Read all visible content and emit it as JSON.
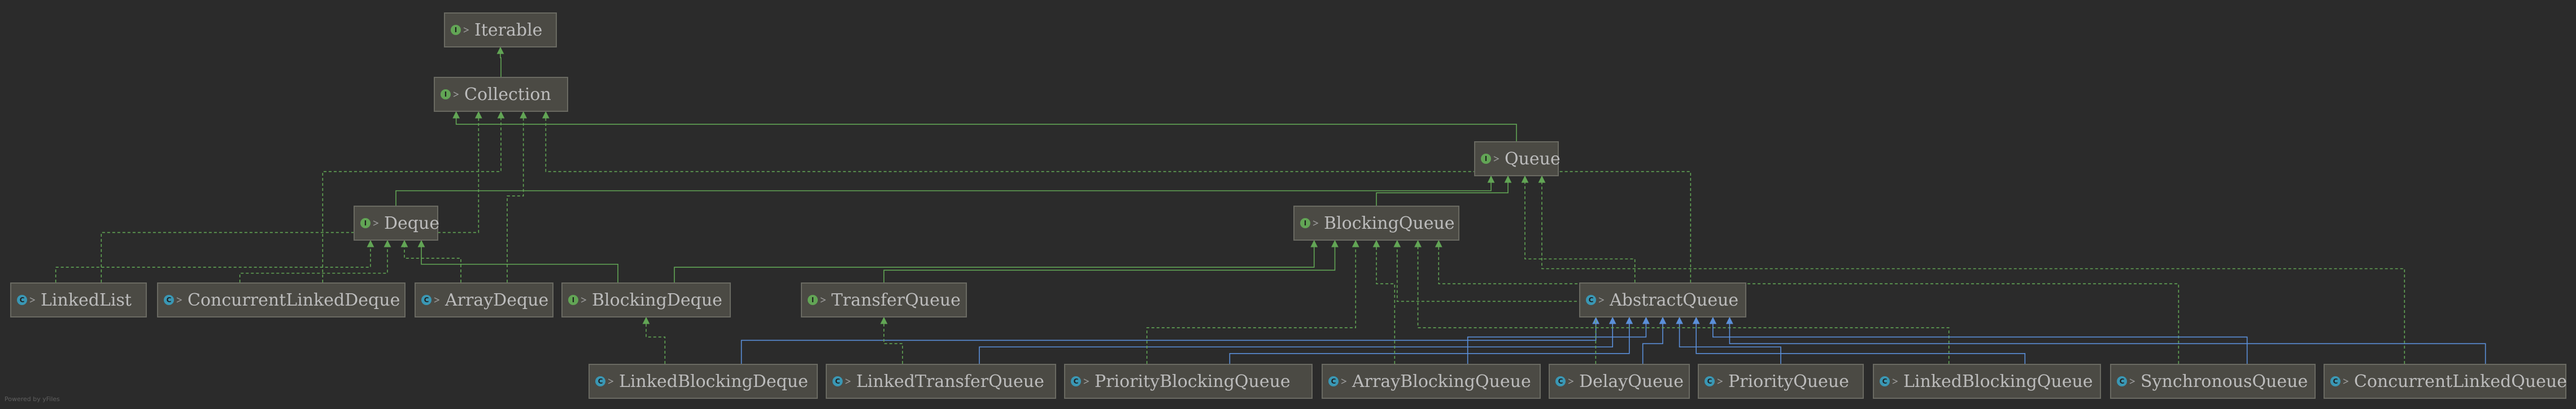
{
  "diagram": {
    "nodes": [
      {
        "id": "Iterable",
        "label": "Iterable",
        "kind": "interface",
        "icon": "interface-icon"
      },
      {
        "id": "Collection",
        "label": "Collection",
        "kind": "interface",
        "icon": "interface-icon"
      },
      {
        "id": "Queue",
        "label": "Queue",
        "kind": "interface",
        "icon": "interface-icon"
      },
      {
        "id": "Deque",
        "label": "Deque",
        "kind": "interface",
        "icon": "interface-icon"
      },
      {
        "id": "BlockingQueue",
        "label": "BlockingQueue",
        "kind": "interface",
        "icon": "interface-icon"
      },
      {
        "id": "LinkedList",
        "label": "LinkedList",
        "kind": "class",
        "icon": "class-icon"
      },
      {
        "id": "ConcurrentLinkedDeque",
        "label": "ConcurrentLinkedDeque",
        "kind": "class",
        "icon": "class-icon"
      },
      {
        "id": "ArrayDeque",
        "label": "ArrayDeque",
        "kind": "class",
        "icon": "class-icon"
      },
      {
        "id": "BlockingDeque",
        "label": "BlockingDeque",
        "kind": "interface",
        "icon": "interface-icon"
      },
      {
        "id": "TransferQueue",
        "label": "TransferQueue",
        "kind": "interface",
        "icon": "interface-icon"
      },
      {
        "id": "AbstractQueue",
        "label": "AbstractQueue",
        "kind": "class",
        "icon": "class-icon"
      },
      {
        "id": "LinkedBlockingDeque",
        "label": "LinkedBlockingDeque",
        "kind": "class",
        "icon": "class-icon"
      },
      {
        "id": "LinkedTransferQueue",
        "label": "LinkedTransferQueue",
        "kind": "class",
        "icon": "class-icon"
      },
      {
        "id": "PriorityBlockingQueue",
        "label": "PriorityBlockingQueue",
        "kind": "class",
        "icon": "class-icon"
      },
      {
        "id": "ArrayBlockingQueue",
        "label": "ArrayBlockingQueue",
        "kind": "class",
        "icon": "class-icon"
      },
      {
        "id": "DelayQueue",
        "label": "DelayQueue",
        "kind": "class",
        "icon": "class-icon"
      },
      {
        "id": "PriorityQueue",
        "label": "PriorityQueue",
        "kind": "class",
        "icon": "class-icon"
      },
      {
        "id": "LinkedBlockingQueue",
        "label": "LinkedBlockingQueue",
        "kind": "class",
        "icon": "class-icon"
      },
      {
        "id": "SynchronousQueue",
        "label": "SynchronousQueue",
        "kind": "class",
        "icon": "class-icon"
      },
      {
        "id": "ConcurrentLinkedQueue",
        "label": "ConcurrentLinkedQueue",
        "kind": "class",
        "icon": "class-icon"
      }
    ],
    "edges": [
      {
        "from": "Collection",
        "to": "Iterable",
        "type": "extends"
      },
      {
        "from": "Queue",
        "to": "Collection",
        "type": "extends"
      },
      {
        "from": "Deque",
        "to": "Queue",
        "type": "extends"
      },
      {
        "from": "BlockingQueue",
        "to": "Queue",
        "type": "extends"
      },
      {
        "from": "LinkedList",
        "to": "Deque",
        "type": "implements"
      },
      {
        "from": "LinkedList",
        "to": "Collection",
        "type": "implements"
      },
      {
        "from": "ConcurrentLinkedDeque",
        "to": "Deque",
        "type": "implements"
      },
      {
        "from": "ConcurrentLinkedDeque",
        "to": "Collection",
        "type": "implements"
      },
      {
        "from": "ArrayDeque",
        "to": "Deque",
        "type": "implements"
      },
      {
        "from": "ArrayDeque",
        "to": "Collection",
        "type": "implements"
      },
      {
        "from": "BlockingDeque",
        "to": "Deque",
        "type": "extends"
      },
      {
        "from": "BlockingDeque",
        "to": "BlockingQueue",
        "type": "extends"
      },
      {
        "from": "TransferQueue",
        "to": "BlockingQueue",
        "type": "extends"
      },
      {
        "from": "AbstractQueue",
        "to": "Queue",
        "type": "implements"
      },
      {
        "from": "AbstractQueue",
        "to": "Collection",
        "type": "implements"
      },
      {
        "from": "LinkedBlockingDeque",
        "to": "BlockingDeque",
        "type": "implements"
      },
      {
        "from": "LinkedBlockingDeque",
        "to": "AbstractQueue",
        "type": "extends"
      },
      {
        "from": "LinkedTransferQueue",
        "to": "TransferQueue",
        "type": "implements"
      },
      {
        "from": "LinkedTransferQueue",
        "to": "AbstractQueue",
        "type": "extends"
      },
      {
        "from": "PriorityBlockingQueue",
        "to": "BlockingQueue",
        "type": "implements"
      },
      {
        "from": "PriorityBlockingQueue",
        "to": "AbstractQueue",
        "type": "extends"
      },
      {
        "from": "ArrayBlockingQueue",
        "to": "BlockingQueue",
        "type": "implements"
      },
      {
        "from": "ArrayBlockingQueue",
        "to": "AbstractQueue",
        "type": "extends"
      },
      {
        "from": "DelayQueue",
        "to": "BlockingQueue",
        "type": "implements"
      },
      {
        "from": "DelayQueue",
        "to": "AbstractQueue",
        "type": "extends"
      },
      {
        "from": "PriorityQueue",
        "to": "AbstractQueue",
        "type": "extends"
      },
      {
        "from": "LinkedBlockingQueue",
        "to": "BlockingQueue",
        "type": "implements"
      },
      {
        "from": "LinkedBlockingQueue",
        "to": "AbstractQueue",
        "type": "extends"
      },
      {
        "from": "SynchronousQueue",
        "to": "BlockingQueue",
        "type": "implements"
      },
      {
        "from": "SynchronousQueue",
        "to": "AbstractQueue",
        "type": "extends"
      },
      {
        "from": "ConcurrentLinkedQueue",
        "to": "Queue",
        "type": "implements"
      },
      {
        "from": "ConcurrentLinkedQueue",
        "to": "AbstractQueue",
        "type": "extends"
      }
    ],
    "colors": {
      "background": "#2b2b2b",
      "node_fill": "#4b4a44",
      "node_border": "#6a6a62",
      "node_text": "#bcbcbc",
      "interface_icon": "#62a555",
      "class_icon": "#3a97b4",
      "edge_interface": "#62a555",
      "edge_class": "#5b8fd9"
    }
  },
  "footer": {
    "powered_by": "Powered by yFiles"
  }
}
